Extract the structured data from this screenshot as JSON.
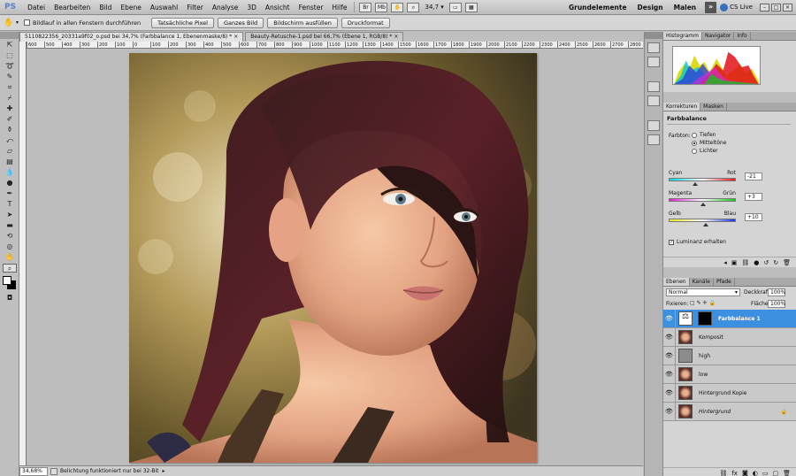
{
  "app": {
    "logo": "PS",
    "menu": [
      "Datei",
      "Bearbeiten",
      "Bild",
      "Ebene",
      "Auswahl",
      "Filter",
      "Analyse",
      "3D",
      "Ansicht",
      "Fenster",
      "Hilfe"
    ],
    "zoom": "34,7",
    "workspaces": [
      "Grundelemente",
      "Design",
      "Malen"
    ],
    "more": "»",
    "cslive": "CS Live",
    "icons": [
      "bridge-icon",
      "mini-bridge-icon",
      "hand-icon",
      "zoom-icon",
      "screen-mode-icon"
    ]
  },
  "options": {
    "checkbox_label": "Bildlauf in allen Fenstern durchführen",
    "buttons": [
      "Tatsächliche Pixel",
      "Ganzes Bild",
      "Bildschirm ausfüllen",
      "Druckformat"
    ]
  },
  "tabs": [
    {
      "label": "5110822356_20331a9f02_o.psd bei 34,7% (Farbbalance 1, Ebenenmaske/8) *",
      "close": "×"
    },
    {
      "label": "Beauty-Retusche-1.psd bei 66,7% (Ebene 1, RGB/8) *",
      "close": "×"
    }
  ],
  "ruler": [
    "600",
    "500",
    "400",
    "300",
    "200",
    "100",
    "0",
    "100",
    "200",
    "300",
    "400",
    "500",
    "600",
    "700",
    "800",
    "900",
    "1000",
    "1100",
    "1200",
    "1300",
    "1400",
    "1500",
    "1600",
    "1700",
    "1800",
    "1900",
    "2000",
    "2100",
    "2200",
    "2300",
    "2400",
    "2500",
    "2600",
    "2700",
    "2800"
  ],
  "status": {
    "zoom": "34,68%",
    "message": "Belichtung funktioniert nur bei 32-Bit"
  },
  "panels": {
    "histogram_tabs": [
      "Histogramm",
      "Navigator",
      "Info"
    ],
    "adjust_tabs": [
      "Korrekturen",
      "Masken"
    ],
    "adjust_title": "Farbbalance",
    "tone_label": "Farbton:",
    "tones": [
      {
        "label": "Tiefen",
        "selected": false
      },
      {
        "label": "Mitteltöne",
        "selected": true
      },
      {
        "label": "Lichter",
        "selected": false
      }
    ],
    "sliders": [
      {
        "left": "Cyan",
        "right": "Rot",
        "value": "-21",
        "level": -21
      },
      {
        "left": "Magenta",
        "right": "Grün",
        "value": "+3",
        "level": 3
      },
      {
        "left": "Gelb",
        "right": "Blau",
        "value": "+10",
        "level": 10
      }
    ],
    "luminance_label": "Luminanz erhalten",
    "layer_tabs": [
      "Ebenen",
      "Kanäle",
      "Pfade"
    ],
    "blend_mode": "Normal",
    "opacity_label": "Deckkraft:",
    "opacity_value": "100%",
    "lock_label": "Fixieren:",
    "fill_label": "Fläche:",
    "fill_value": "100%",
    "layers": [
      {
        "name": "Farbbalance 1",
        "selected": true,
        "type": "adjustment"
      },
      {
        "name": "Komposit",
        "selected": false,
        "type": "photo"
      },
      {
        "name": "high",
        "selected": false,
        "type": "gray"
      },
      {
        "name": "low",
        "selected": false,
        "type": "photo"
      },
      {
        "name": "Hintergrund Kopie",
        "selected": false,
        "type": "photo"
      },
      {
        "name": "Hintergrund",
        "selected": false,
        "type": "photo",
        "locked": true
      }
    ]
  },
  "colors": {
    "accent": "#3d8fe0",
    "panel_bg": "#bdbdbd"
  }
}
